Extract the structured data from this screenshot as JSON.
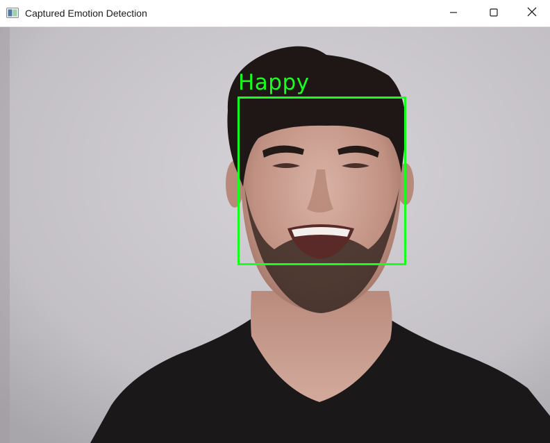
{
  "window": {
    "title": "Captured Emotion Detection",
    "controls": [
      "minimize-icon",
      "maximize-icon",
      "close-icon"
    ]
  },
  "detection": {
    "label": "Happy",
    "box_color": "#17ff1c"
  },
  "colors": {
    "background_wall": "#c7c4c9",
    "shirt": "#1a1819",
    "detection_green": "#17ff1c"
  }
}
